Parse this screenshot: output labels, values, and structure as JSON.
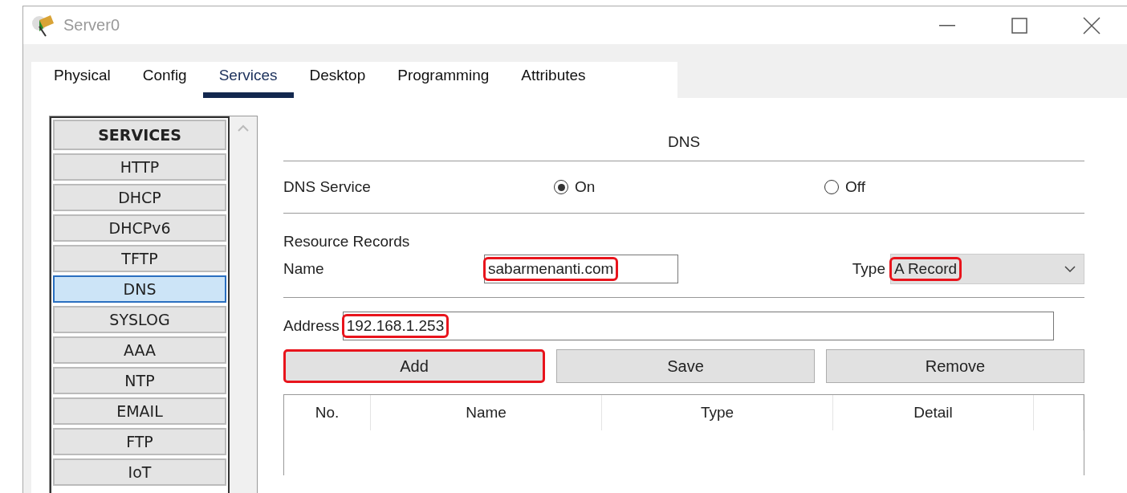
{
  "window": {
    "title": "Server0"
  },
  "tabs": [
    {
      "label": "Physical",
      "selected": false
    },
    {
      "label": "Config",
      "selected": false
    },
    {
      "label": "Services",
      "selected": true
    },
    {
      "label": "Desktop",
      "selected": false
    },
    {
      "label": "Programming",
      "selected": false
    },
    {
      "label": "Attributes",
      "selected": false
    }
  ],
  "sidebar": {
    "heading": "SERVICES",
    "items": [
      {
        "label": "HTTP",
        "selected": false
      },
      {
        "label": "DHCP",
        "selected": false
      },
      {
        "label": "DHCPv6",
        "selected": false
      },
      {
        "label": "TFTP",
        "selected": false
      },
      {
        "label": "DNS",
        "selected": true
      },
      {
        "label": "SYSLOG",
        "selected": false
      },
      {
        "label": "AAA",
        "selected": false
      },
      {
        "label": "NTP",
        "selected": false
      },
      {
        "label": "EMAIL",
        "selected": false
      },
      {
        "label": "FTP",
        "selected": false
      },
      {
        "label": "IoT",
        "selected": false
      }
    ]
  },
  "panel": {
    "title": "DNS",
    "service_label": "DNS Service",
    "service_options": [
      {
        "label": "On",
        "selected": true
      },
      {
        "label": "Off",
        "selected": false
      }
    ],
    "records_label": "Resource Records",
    "name_field": {
      "label": "Name",
      "value": "sabarmenanti.com",
      "highlighted": true
    },
    "type_field": {
      "label": "Type",
      "value": "A Record",
      "highlighted": true
    },
    "address_field": {
      "label": "Address",
      "value": "192.168.1.253",
      "highlighted": true
    },
    "buttons": [
      {
        "label": "Add",
        "highlighted": true
      },
      {
        "label": "Save",
        "highlighted": false
      },
      {
        "label": "Remove",
        "highlighted": false
      }
    ],
    "table": {
      "columns": [
        "No.",
        "Name",
        "Type",
        "Detail"
      ]
    }
  }
}
